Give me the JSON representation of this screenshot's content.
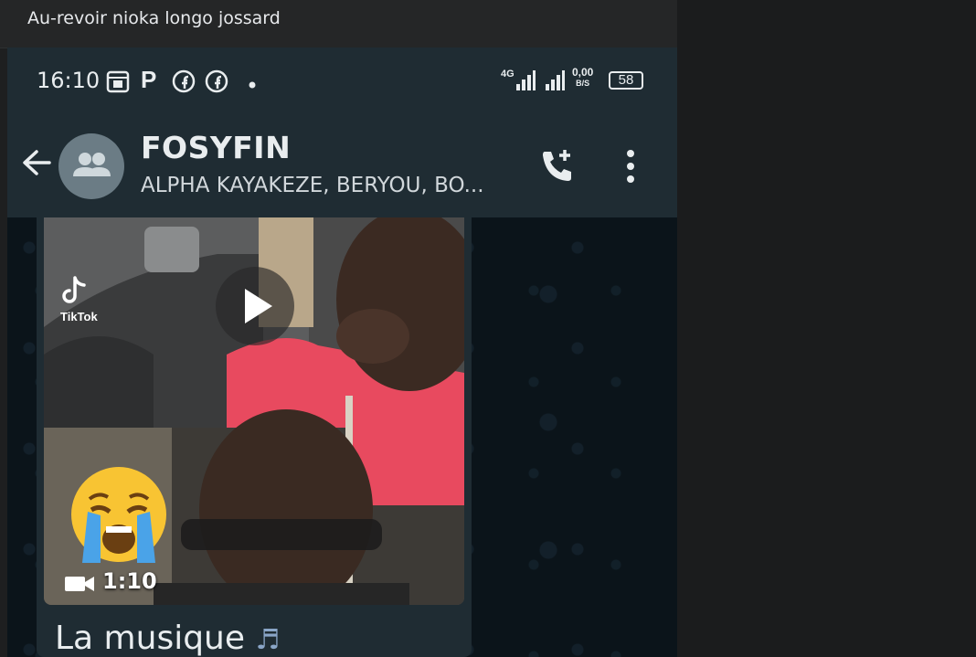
{
  "post": {
    "caption": "Au-revoir nioka longo jossard"
  },
  "status_bar": {
    "time": "16:10",
    "p_label": "P",
    "network": "4G",
    "speed_value": "0,00",
    "speed_unit": "B/S",
    "battery": "58"
  },
  "chat_header": {
    "title": "FOSYFIN",
    "members": "ALPHA KAYAKEZE, BERYOU, BO..."
  },
  "message": {
    "watermark": "TikTok",
    "duration": "1:10",
    "text": "La musique",
    "emoji": "😭",
    "notes": "♬"
  },
  "colors": {
    "header": "#1f2c33",
    "chat_bg": "#0b141a",
    "bubble": "#1f2c33",
    "text": "#e9edef"
  }
}
